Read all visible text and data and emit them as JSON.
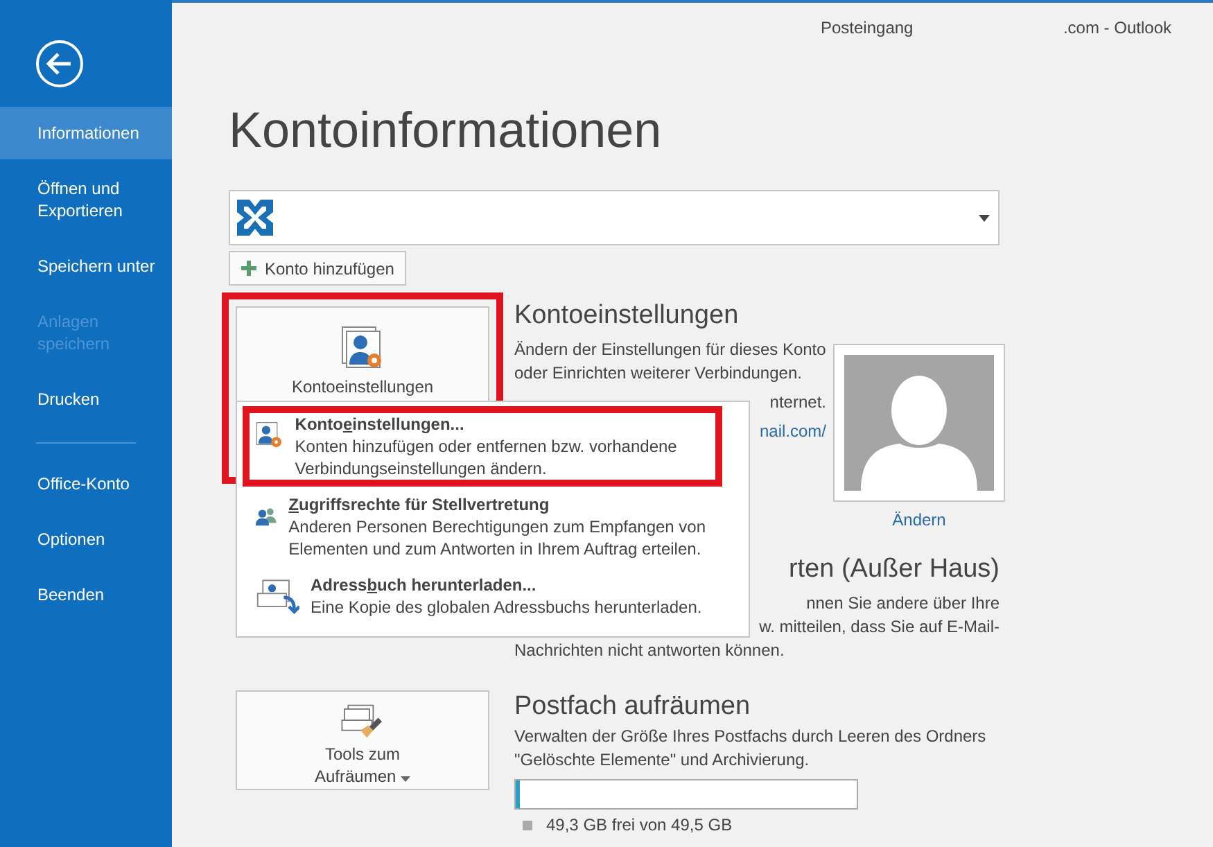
{
  "title_bar": {
    "folder": "Posteingang",
    "app_title": ".com - Outlook"
  },
  "sidebar": {
    "groups": [
      [
        {
          "label": "Informationen",
          "selected": true,
          "disabled": false
        },
        {
          "label": "Öffnen und Exportieren",
          "selected": false,
          "disabled": false
        },
        {
          "label": "Speichern unter",
          "selected": false,
          "disabled": false
        },
        {
          "label": "Anlagen speichern",
          "selected": false,
          "disabled": true
        },
        {
          "label": "Drucken",
          "selected": false,
          "disabled": false
        }
      ],
      [
        {
          "label": "Office-Konto",
          "selected": false,
          "disabled": false
        },
        {
          "label": "Optionen",
          "selected": false,
          "disabled": false
        },
        {
          "label": "Beenden",
          "selected": false,
          "disabled": false
        }
      ]
    ]
  },
  "page_title": "Kontoinformationen",
  "add_account_button": "Konto hinzufügen",
  "sections": [
    {
      "kind": "account",
      "button": {
        "label": "Kontoeinstellungen",
        "highlighted": true
      },
      "heading": "Kontoeinstellungen",
      "description": "Ändern der Einstellungen für dieses Konto oder Einrichten weiterer Verbindungen.",
      "lines": [
        {
          "text": "nternet.",
          "covered": true,
          "link": false
        },
        {
          "text": "nail.com/",
          "covered": true,
          "link": true
        }
      ],
      "photo_link": "Ändern"
    },
    {
      "kind": "auto_reply",
      "heading": "rten (Außer Haus)",
      "lines": [
        {
          "text": "nnen Sie andere über Ihre",
          "covered": true,
          "link": false
        },
        {
          "text": "w. mitteilen, dass Sie auf E-Mail-",
          "covered": true,
          "link": false
        },
        {
          "text": "Nachrichten nicht antworten können.",
          "covered": false,
          "link": false
        }
      ]
    },
    {
      "kind": "cleanup",
      "button": {
        "label": "Tools zum Aufräumen",
        "highlighted": false
      },
      "heading": "Postfach aufräumen",
      "description": "Verwalten der Größe Ihres Postfachs durch Leeren des Ordners \"Gelöschte Elemente\" und Archivierung.",
      "storage": {
        "level": 0.01,
        "reading": "49,3 GB frei von 49,5 GB"
      }
    }
  ],
  "menu": {
    "items": [
      {
        "kind": "settings",
        "title": {
          "before": "Konto",
          "key": "e",
          "after": "instellungen..."
        },
        "description": "Konten hinzufügen oder entfernen bzw. vorhandene Verbindungseinstellungen ändern.",
        "highlighted": true
      },
      {
        "kind": "delegate",
        "title": {
          "key": "Z",
          "after": "ugriffsrechte für Stellvertretung"
        },
        "description": "Anderen Personen Berechtigungen zum Empfangen von Elementen und zum Antworten in Ihrem Auftrag erteilen.",
        "highlighted": false
      },
      {
        "kind": "addressbook",
        "title": {
          "before": "Adress",
          "key": "b",
          "after": "uch herunterladen..."
        },
        "description": "Eine Kopie des globalen Adressbuchs herunterladen.",
        "highlighted": false
      }
    ]
  }
}
